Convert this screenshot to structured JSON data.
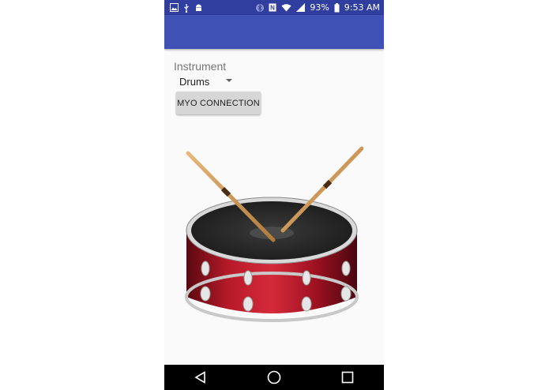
{
  "status_bar": {
    "battery": "93%",
    "time": "9:53 AM",
    "icons": [
      "image-icon",
      "usb-icon",
      "android-icon",
      "bluetooth-icon",
      "nfc-icon",
      "wifi-icon",
      "signal-icon",
      "battery-icon"
    ]
  },
  "form": {
    "instrument_label": "Instrument",
    "instrument_value": "Drums",
    "myo_button_label": "MYO CONNECTION"
  },
  "nav_bar": {
    "icons": [
      "back-icon",
      "home-icon",
      "recents-icon"
    ]
  },
  "colors": {
    "status_bar": "#303f9f",
    "app_bar": "#3f51b5",
    "background": "#fafafa",
    "button": "#d6d6d6",
    "drum_shell": "#9b1020"
  }
}
